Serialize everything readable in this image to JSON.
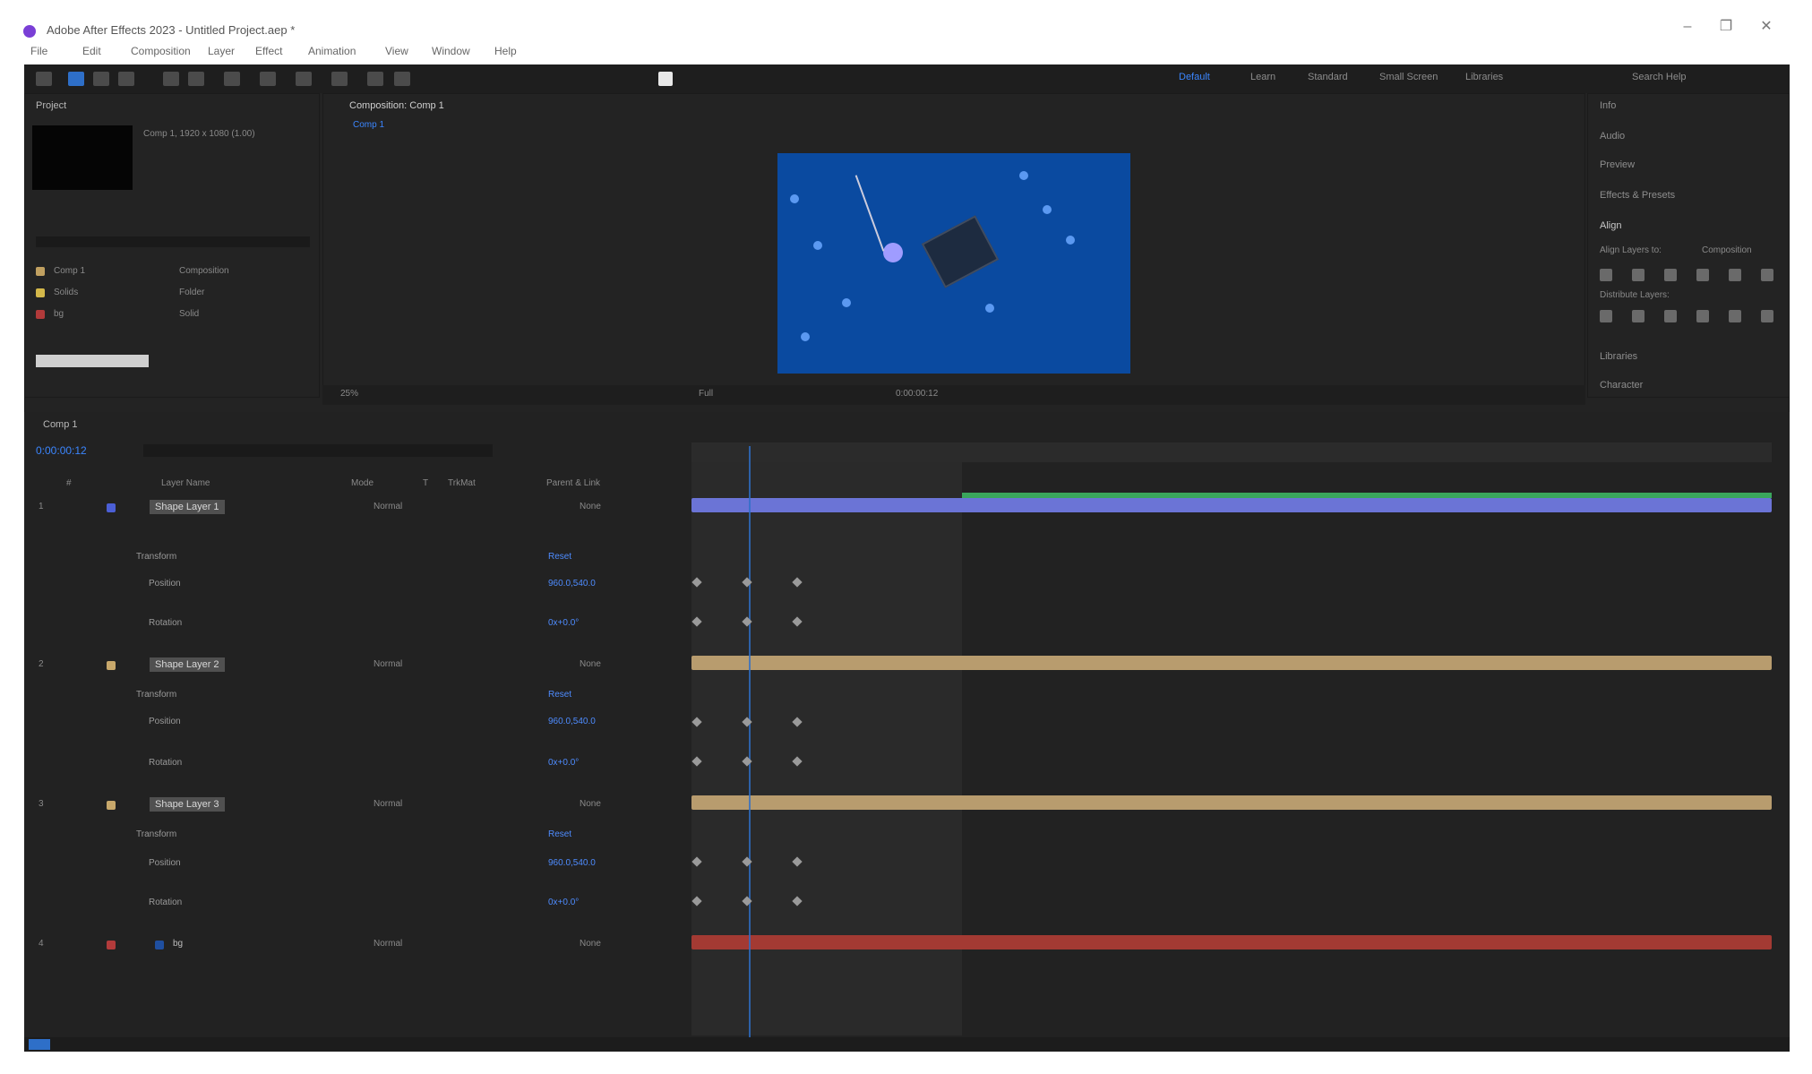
{
  "window": {
    "title": "Adobe After Effects 2023 - Untitled Project.aep *",
    "controls": {
      "minimize": "–",
      "maximize": "❐",
      "close": "✕"
    }
  },
  "menu": [
    "File",
    "Edit",
    "Composition",
    "Layer",
    "Effect",
    "Animation",
    "View",
    "Window",
    "Help"
  ],
  "toolbar": {
    "workspaces": [
      "Default",
      "Learn",
      "Standard",
      "Small Screen",
      "Libraries"
    ],
    "search_placeholder": "Search Help"
  },
  "project_panel": {
    "tab": "Project",
    "comp_info": "Comp 1, 1920 x 1080 (1.00)",
    "items": [
      {
        "name": "Comp 1",
        "type": "Composition"
      },
      {
        "name": "Solids",
        "type": "Folder"
      },
      {
        "name": "bg",
        "type": "Solid"
      }
    ]
  },
  "comp_panel": {
    "tab": "Composition: Comp 1",
    "sub_tab": "Comp 1",
    "zoom": "25%",
    "quality": "Full",
    "timecode": "0:00:00:12"
  },
  "timeline": {
    "tabs": [
      "Comp 1"
    ],
    "timecode": "0:00:00:12",
    "columns": [
      "#",
      "Layer Name",
      "Mode",
      "T",
      "TrkMat",
      "Parent & Link"
    ],
    "layers": [
      {
        "index": "1",
        "name": "Shape Layer 1",
        "color": "#4b5fd6",
        "props": [
          {
            "label": "Transform",
            "value": "Reset"
          },
          {
            "label": "Position",
            "value": "960.0,540.0"
          },
          {
            "label": "Rotation",
            "value": "0x+0.0°"
          }
        ]
      },
      {
        "index": "2",
        "name": "Shape Layer 2",
        "color": "#c8a86b",
        "props": [
          {
            "label": "Transform",
            "value": "Reset"
          },
          {
            "label": "Position",
            "value": "960.0,540.0"
          },
          {
            "label": "Rotation",
            "value": "0x+0.0°"
          }
        ]
      },
      {
        "index": "3",
        "name": "Shape Layer 3",
        "color": "#c8a86b",
        "props": [
          {
            "label": "Transform",
            "value": "Reset"
          },
          {
            "label": "Position",
            "value": "960.0,540.0"
          },
          {
            "label": "Rotation",
            "value": "0x+0.0°"
          }
        ]
      },
      {
        "index": "4",
        "name": "bg",
        "color": "#b23b3b",
        "props": []
      }
    ],
    "mode_value": "Normal",
    "parent_value": "None"
  },
  "right_panel": {
    "items": [
      "Info",
      "Audio",
      "Preview",
      "Effects & Presets",
      "Align",
      "Align Layers to:",
      "Distribute Layers:",
      "Libraries",
      "Character"
    ],
    "align_target": "Composition"
  },
  "colors": {
    "app_bg": "#232323",
    "comp_bg": "#0a4aa0",
    "accent_blue": "#2e6fc8",
    "bar_purple": "#6b74d6",
    "bar_tan": "#b89c6e",
    "bar_red": "#a33a33",
    "bar_green": "#3aa65c"
  }
}
